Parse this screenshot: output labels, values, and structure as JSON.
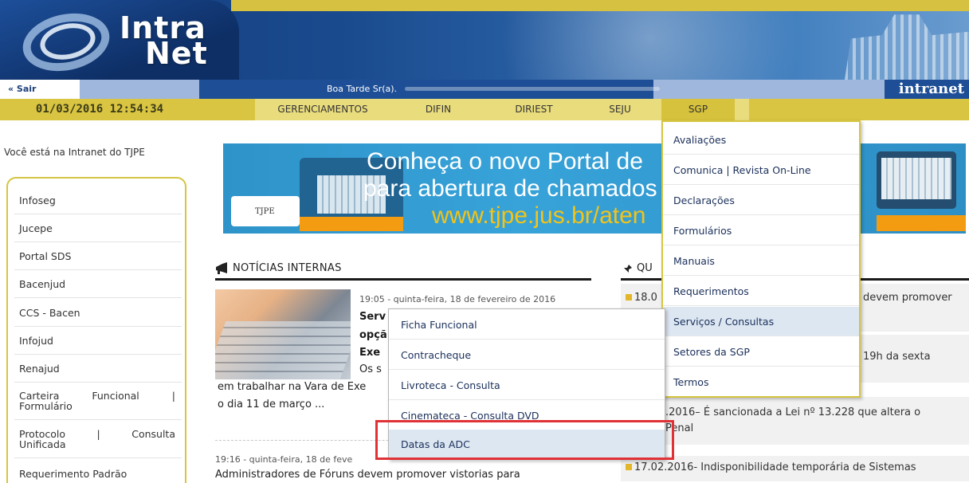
{
  "header": {
    "logo_line1": "Intra",
    "logo_line2": "Net",
    "exit_link": "« Sair",
    "greeting": "Boa Tarde Sr(a).",
    "brand": "intranet"
  },
  "nav": {
    "datetime": "01/03/2016 12:54:34",
    "items": [
      {
        "label": "GERENCIAMENTOS"
      },
      {
        "label": "DIFIN"
      },
      {
        "label": "DIRIEST"
      },
      {
        "label": "SEJU"
      },
      {
        "label": "SGP"
      }
    ],
    "active_item": "SGP"
  },
  "location_text": "Você está na Intranet do TJPE",
  "sidebar": {
    "items": [
      {
        "label": "Infoseg"
      },
      {
        "label": "Jucepe"
      },
      {
        "label": "Portal SDS"
      },
      {
        "label": "Bacenjud"
      },
      {
        "label": "CCS - Bacen"
      },
      {
        "label": "Infojud"
      },
      {
        "label": "Renajud"
      },
      {
        "label_a": "Carteira",
        "label_b": "Funcional",
        "label_c": "|",
        "label_d": "Formulário"
      },
      {
        "label_a": "Protocolo",
        "label_b": "|",
        "label_c": "Consulta",
        "label_d": "Unificada"
      },
      {
        "label": "Requerimento Padrão"
      }
    ]
  },
  "promo": {
    "line1": "Conheça o novo Portal de",
    "line2": "para abertura de chamados",
    "line3": "www.tjpe.jus.br/aten",
    "seal_text": "TJPE"
  },
  "news": {
    "section_title": "NOTÍCIAS INTERNAS",
    "item1": {
      "date": "19:05 - quinta-feira, 18 de fevereiro de 2016",
      "line1": "Serv",
      "line2": "opçã",
      "line3": "Exe",
      "line4": "Os s",
      "line5": "em trabalhar na Vara de Exe",
      "line6": "o dia 11 de março ..."
    },
    "item2": {
      "date": "19:16 - quinta-feira, 18 de feve",
      "title": "Administradores de Fóruns devem promover vistorias para"
    }
  },
  "right_news": {
    "section_title": "QU",
    "items": [
      {
        "prefix": "18.0",
        "suffix": "devem promover"
      },
      {
        "prefix": "",
        "suffix": "19h da sexta"
      },
      {
        "prefix": ".2016",
        "suffix": "– É sancionada a Lei nº 13.228 que altera o",
        "line2": "Penal"
      },
      {
        "prefix": "17.02.2016",
        "suffix": "- Indisponibilidade temporária de Sistemas"
      }
    ]
  },
  "sgp_menu": {
    "items": [
      {
        "label": "Avaliações"
      },
      {
        "label": "Comunica | Revista On-Line"
      },
      {
        "label": "Declarações"
      },
      {
        "label": "Formulários"
      },
      {
        "label": "Manuais"
      },
      {
        "label": "Requerimentos"
      },
      {
        "label": "Serviços / Consultas"
      },
      {
        "label": "Setores da SGP"
      },
      {
        "label": "Termos"
      }
    ],
    "highlighted": "Serviços / Consultas"
  },
  "servicos_submenu": {
    "items": [
      {
        "label": "Ficha Funcional"
      },
      {
        "label": "Contracheque"
      },
      {
        "label": "Livroteca - Consulta"
      },
      {
        "label": "Cinemateca - Consulta DVD"
      },
      {
        "label": "Datas da ADC"
      }
    ],
    "highlighted": "Datas da ADC"
  },
  "colors": {
    "gold": "#d6c541",
    "navy": "#1e4f96",
    "highlight": "#e03236"
  }
}
